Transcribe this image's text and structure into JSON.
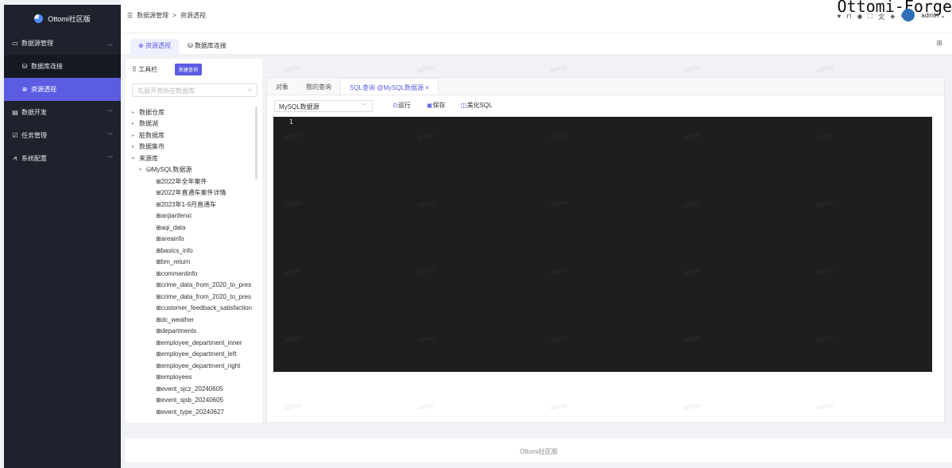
{
  "brand": {
    "name": "Ottomi社区版"
  },
  "sidebar": {
    "items": [
      {
        "label": "数据源管理",
        "icon": "folder-icon"
      },
      {
        "label": "数据库连接",
        "icon": "database-icon"
      },
      {
        "label": "资源透视",
        "icon": "globe-icon"
      },
      {
        "label": "数据开发",
        "icon": "calendar-icon"
      },
      {
        "label": "任务管理",
        "icon": "checkbox-icon"
      },
      {
        "label": "系统配置",
        "icon": "user-icon"
      }
    ]
  },
  "breadcrumb": {
    "parent": "数据源管理",
    "sep": ">",
    "current": "资源透视"
  },
  "header": {
    "watermark": "Ottomi-Forge",
    "user": "admin"
  },
  "page_tabs": [
    "资源透视",
    "数据库连接"
  ],
  "toolbar": {
    "title": "工具栏",
    "new_query": "新建查询"
  },
  "search": {
    "placeholder": "先展开表所在数据库"
  },
  "tree": {
    "groups": [
      "数据仓库",
      "数据湖",
      "脏数据库",
      "数据集市",
      "来源库"
    ],
    "source": "MySQL数据源",
    "tables": [
      "2022年全年案件",
      "2022年直通车案件详情",
      "2023年1-9月直通车",
      "anjianfenxi",
      "aqi_data",
      "areainfo",
      "basics_info",
      "bm_return",
      "commentinfo",
      "crime_data_from_2020_to_pres",
      "crime_data_from_2020_to_pres",
      "customer_feedback_satisfaction",
      "dc_weather",
      "departments",
      "employee_department_inner",
      "employee_department_left",
      "employee_department_right",
      "employees",
      "event_sjcz_20240605",
      "event_sjsb_20240605",
      "event_type_20240627"
    ]
  },
  "editor_tabs": [
    "对象",
    "我的查询",
    "SQL查询 @MySQL数据源 ×"
  ],
  "editor": {
    "datasource": "MySQL数据源",
    "run": "运行",
    "save": "保存",
    "beautify": "美化SQL",
    "line": "1"
  },
  "footer": {
    "text": "Ottomi社区版"
  },
  "watermark": {
    "text": "admin"
  }
}
